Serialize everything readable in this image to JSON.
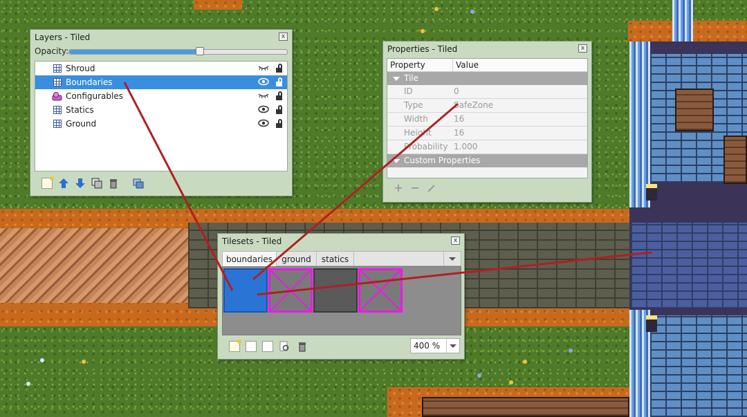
{
  "layers_window": {
    "title": "Layers - Tiled",
    "close_label": "x",
    "opacity_label": "Opacity:",
    "opacity_value": 0.6,
    "layers": [
      {
        "name": "Shroud",
        "type": "tile",
        "visible": false,
        "selected": false
      },
      {
        "name": "Boundaries",
        "type": "tile",
        "visible": true,
        "selected": true
      },
      {
        "name": "Configurables",
        "type": "object",
        "visible": false,
        "selected": false
      },
      {
        "name": "Statics",
        "type": "tile",
        "visible": true,
        "selected": false
      },
      {
        "name": "Ground",
        "type": "tile",
        "visible": true,
        "selected": false
      }
    ],
    "toolbar": [
      "new-layer-icon",
      "move-layer-up-icon",
      "move-layer-down-icon",
      "duplicate-layer-icon",
      "delete-layer-icon",
      "layer-properties-icon"
    ]
  },
  "properties_window": {
    "title": "Properties - Tiled",
    "close_label": "x",
    "columns": [
      "Property",
      "Value"
    ],
    "group_tile": "Tile",
    "rows": [
      {
        "key": "ID",
        "value": "0"
      },
      {
        "key": "Type",
        "value": "SafeZone"
      },
      {
        "key": "Width",
        "value": "16"
      },
      {
        "key": "Height",
        "value": "16"
      },
      {
        "key": "Probability",
        "value": "1.000"
      }
    ],
    "group_custom": "Custom Properties",
    "toolbar": [
      "add-property-icon",
      "remove-property-icon",
      "edit-property-icon"
    ]
  },
  "tilesets_window": {
    "title": "Tilesets - Tiled",
    "close_label": "x",
    "tabs": [
      "boundaries",
      "ground",
      "statics"
    ],
    "active_tab": "boundaries",
    "tiles": [
      {
        "kind": "solid",
        "color": "#2a74d6",
        "selected": true
      },
      {
        "kind": "cross",
        "color": "#ee18e8",
        "selected": false
      },
      {
        "kind": "solid",
        "color": "#5a5a5a",
        "selected": false
      },
      {
        "kind": "cross",
        "color": "#ee18e8",
        "selected": false
      }
    ],
    "zoom": "400 %",
    "toolbar": [
      "new-tileset-icon",
      "import-tileset-icon",
      "export-tileset-icon",
      "edit-tileset-icon",
      "delete-tileset-icon"
    ]
  },
  "colors": {
    "selection": "#3a8ee0",
    "window_frame": "#c8dbc1",
    "annotation_line": "#b02020",
    "grass": "#4f7a2a",
    "dirt": "#c86a1e"
  }
}
